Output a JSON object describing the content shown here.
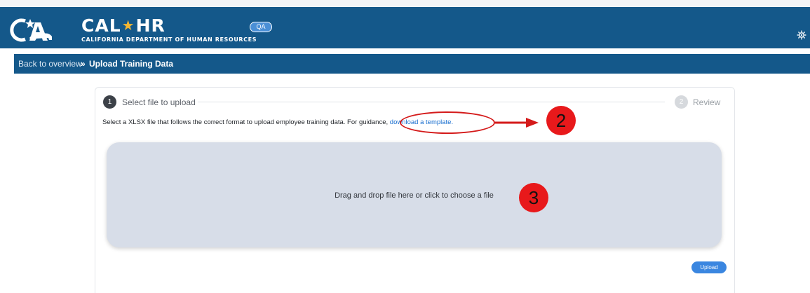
{
  "header": {
    "ca_logo_text": "CA",
    "brand_left": "CAL",
    "brand_star": "★",
    "brand_right": "HR",
    "subtitle": "CALIFORNIA DEPARTMENT OF HUMAN RESOURCES",
    "env_badge": "QA",
    "settings_icon": "gear-icon",
    "colors": {
      "bar": "#14588a",
      "accent_star": "#f2b632"
    }
  },
  "breadcrumb": {
    "back_label": "Back to overview",
    "separator": "»",
    "current": "Upload Training Data"
  },
  "stepper": {
    "steps": [
      {
        "number": "1",
        "label": "Select file to upload",
        "active": true
      },
      {
        "number": "2",
        "label": "Review",
        "active": false
      }
    ]
  },
  "instruction": {
    "text": "Select a XLSX file that follows the correct format to upload employee training data. For guidance,",
    "link_label": "download a template."
  },
  "annotations": {
    "marker_2": "2",
    "marker_3": "3",
    "color": "#e8191b"
  },
  "dropzone": {
    "text": "Drag and drop file here or click to choose a file"
  },
  "actions": {
    "upload_label": "Upload"
  }
}
